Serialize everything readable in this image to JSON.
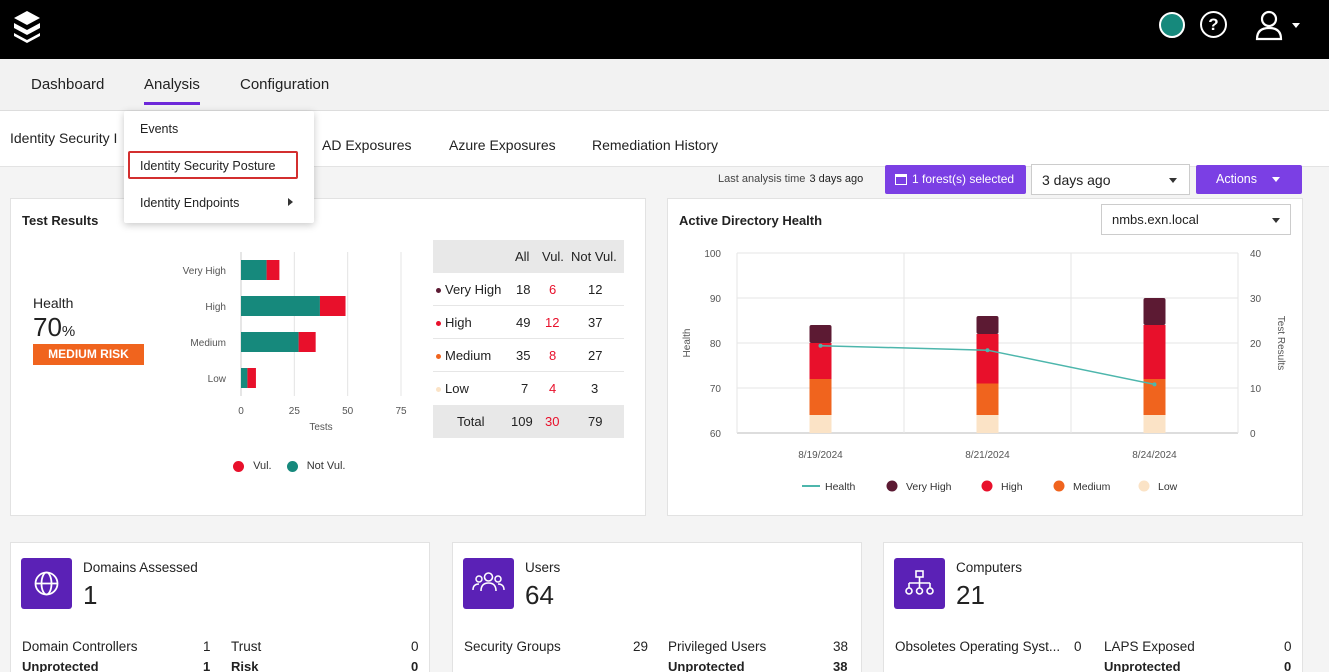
{
  "header": {
    "logo": "stacked-layers-logo",
    "status_color": "#16897c",
    "help_symbol": "?"
  },
  "main_nav": {
    "tabs": [
      "Dashboard",
      "Analysis",
      "Configuration"
    ],
    "active": "Analysis"
  },
  "sub_nav": {
    "tabs": [
      "Identity Security I",
      "AD Exposures",
      "Azure Exposures",
      "Remediation History"
    ]
  },
  "analysis_menu": {
    "items": [
      "Events",
      "Identity Security Posture",
      "Identity Endpoints"
    ],
    "highlighted": "Identity Security Posture"
  },
  "toolbar": {
    "last_analysis_label": "Last analysis time",
    "last_analysis_value": "3 days ago",
    "forest_button": "1 forest(s) selected",
    "time_select": "3 days ago",
    "actions_button": "Actions"
  },
  "test_results": {
    "title": "Test Results",
    "health_label": "Health",
    "health_value": "70",
    "health_unit": "%",
    "risk_badge": "MEDIUM RISK",
    "chart_data": {
      "type": "bar",
      "orientation": "horizontal",
      "stacked": true,
      "categories": [
        "Very High",
        "High",
        "Medium",
        "Low"
      ],
      "series": [
        {
          "name": "Not Vul.",
          "values": [
            12,
            37,
            27,
            3
          ],
          "color": "#16897c"
        },
        {
          "name": "Vul.",
          "values": [
            6,
            12,
            8,
            4
          ],
          "color": "#e8102b"
        }
      ],
      "xlabel": "Tests",
      "xticks": [
        "0",
        "25",
        "50",
        "75"
      ],
      "xlim": [
        0,
        75
      ],
      "legend": [
        "Vul.",
        "Not Vul."
      ]
    },
    "table": {
      "headers": [
        "All",
        "Vul.",
        "Not Vul."
      ],
      "rows": [
        {
          "label": "Very High",
          "color": "#5c1a33",
          "all": "18",
          "vul": "6",
          "not_vul": "12"
        },
        {
          "label": "High",
          "color": "#e8102b",
          "all": "49",
          "vul": "12",
          "not_vul": "37"
        },
        {
          "label": "Medium",
          "color": "#f0641e",
          "all": "35",
          "vul": "8",
          "not_vul": "27"
        },
        {
          "label": "Low",
          "color": "#fbe3c6",
          "all": "7",
          "vul": "4",
          "not_vul": "3"
        }
      ],
      "total": {
        "label": "Total",
        "all": "109",
        "vul": "30",
        "not_vul": "79"
      }
    }
  },
  "ad_health": {
    "title": "Active Directory Health",
    "domain_select": "nmbs.exn.local",
    "chart_data": {
      "type": "bar",
      "stacked": true,
      "categories": [
        "8/19/2024",
        "8/21/2024",
        "8/24/2024"
      ],
      "series": [
        {
          "name": "Low",
          "values": [
            4,
            4,
            4
          ],
          "color": "#fbe3c6"
        },
        {
          "name": "Medium",
          "values": [
            8,
            7,
            8
          ],
          "color": "#f0641e"
        },
        {
          "name": "High",
          "values": [
            8,
            11,
            12
          ],
          "color": "#e8102b"
        },
        {
          "name": "Very High",
          "values": [
            4,
            4,
            6
          ],
          "color": "#5c1a33"
        }
      ],
      "line": {
        "name": "Health",
        "values": [
          79.4,
          78.4,
          70.8
        ],
        "color": "#4db6ac"
      },
      "ylabel_left": "Health",
      "ylim_left": [
        60,
        100
      ],
      "yticks_left": [
        "60",
        "70",
        "80",
        "90",
        "100"
      ],
      "ylabel_right": "Test Results",
      "ylim_right": [
        0,
        40
      ],
      "yticks_right": [
        "0",
        "10",
        "20",
        "30",
        "40"
      ],
      "legend": [
        "Health",
        "Very High",
        "High",
        "Medium",
        "Low"
      ]
    }
  },
  "cards": [
    {
      "title": "Domains Assessed",
      "value": "1",
      "icon": "globe-icon",
      "stats": [
        {
          "label": "Domain Controllers",
          "value": "1",
          "sub_label": "Unprotected",
          "sub_value": "1"
        },
        {
          "label": "Trust",
          "value": "0",
          "sub_label": "Risk",
          "sub_value": "0"
        }
      ]
    },
    {
      "title": "Users",
      "value": "64",
      "icon": "users-icon",
      "stats": [
        {
          "label": "Security Groups",
          "value": "29",
          "sub_label": "",
          "sub_value": ""
        },
        {
          "label": "Privileged Users",
          "value": "38",
          "sub_label": "Unprotected",
          "sub_value": "38"
        }
      ]
    },
    {
      "title": "Computers",
      "value": "21",
      "icon": "network-icon",
      "stats": [
        {
          "label": "Obsoletes Operating Syst...",
          "value": "0",
          "sub_label": "",
          "sub_value": ""
        },
        {
          "label": "LAPS Exposed",
          "value": "0",
          "sub_label": "Unprotected",
          "sub_value": "0"
        }
      ]
    }
  ]
}
